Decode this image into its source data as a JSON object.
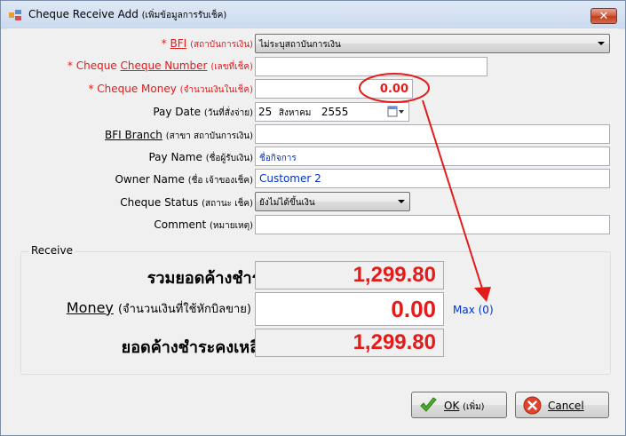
{
  "window": {
    "title": "Cheque Receive Add",
    "title_thai": "(เพิ่มข้อมูลการรับเช็ค)",
    "close_label": "✕"
  },
  "form": {
    "bfi": {
      "label": "BFI",
      "label_thai": "(สถาบันการเงิน)",
      "value": "ไม่ระบุสถาบันการเงิน"
    },
    "cheque_number": {
      "label": "Cheque Number",
      "label_thai": "(เลขที่เช็ค)",
      "value": ""
    },
    "cheque_money": {
      "label": "Cheque Money",
      "label_thai": "(จำนวนเงินในเช็ค)",
      "value": "0.00"
    },
    "pay_date": {
      "label": "Pay Date",
      "label_thai": "(วันที่สั่งจ่าย)",
      "day": "25",
      "month": "สิงหาคม",
      "year": "2555"
    },
    "bfi_branch": {
      "label": "BFI Branch",
      "label_thai": "(สาขา สถาบันการเงิน)",
      "value": ""
    },
    "pay_name": {
      "label": "Pay Name",
      "label_thai": "(ชื่อผู้รับเงิน)",
      "value": "ชื่อกิจการ"
    },
    "owner_name": {
      "label": "Owner Name",
      "label_thai": "(ชื่อ เจ้าของเช็ค)",
      "value": "Customer 2"
    },
    "cheque_status": {
      "label": "Cheque Status",
      "label_thai": "(สถานะ เช็ค)",
      "value": "ยังไม่ได้ขึ้นเงิน"
    },
    "comment": {
      "label": "Comment",
      "label_thai": "(หมายเหตุ)",
      "value": ""
    }
  },
  "receive": {
    "group_title": "Receive",
    "total_label": "รวมยอดค้างชำระ",
    "total_value": "1,299.80",
    "money_label": "Money",
    "money_label_thai": "(จำนวนเงินที่ใช้หักบิลขาย)",
    "money_value": "0.00",
    "max_link": "Max (0)",
    "remaining_label": "ยอดค้างชำระคงเหลือ",
    "remaining_value": "1,299.80"
  },
  "buttons": {
    "ok_label": "OK",
    "ok_thai": "(เพิ่ม)",
    "cancel_label": "Cancel"
  },
  "colors": {
    "required": "#e31b1b",
    "value_red": "#e31b1b",
    "link_blue": "#0033cc",
    "annotation": "#e31b1b"
  }
}
